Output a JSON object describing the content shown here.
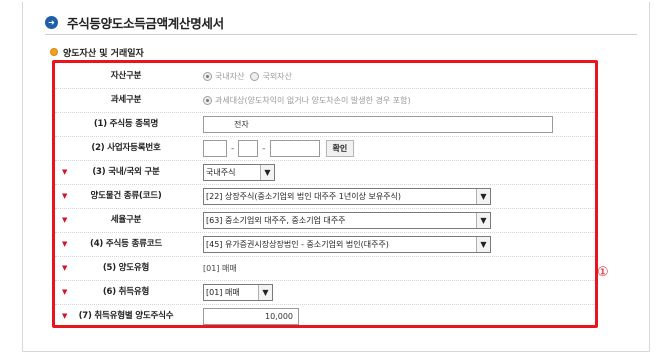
{
  "page": {
    "title": "주식등양도소득금액계산명세서",
    "section": "양도자산 및 거래일자"
  },
  "rows": [
    {
      "label": "자산구분",
      "required": false,
      "radios": [
        {
          "label": "국내자산",
          "checked": true
        },
        {
          "label": "국외자산",
          "checked": false
        }
      ]
    },
    {
      "label": "과세구분",
      "required": false,
      "radio_label": "과세대상(양도차익이 없거나 양도차손이 발생한 경우 포함)"
    },
    {
      "label": "(1) 주식등 종목명",
      "required": false,
      "value": "전자"
    },
    {
      "label": "(2) 사업자등록번호",
      "required": false,
      "parts": [
        "",
        "",
        ""
      ],
      "button": "확인"
    },
    {
      "label": "(3) 국내/국외 구분",
      "required": true,
      "selected": "국내주식"
    },
    {
      "label": "양도물건 종류(코드)",
      "required": true,
      "selected": "[22] 상장주식(중소기업외 법인 대주주 1년이상 보유주식)"
    },
    {
      "label": "세율구분",
      "required": true,
      "selected": "[63] 중소기업외 대주주, 중소기업 대주주"
    },
    {
      "label": "(4) 주식등 종류코드",
      "required": true,
      "selected": "[45] 유가증권시장상장법인 - 중소기업외 법인(대주주)"
    },
    {
      "label": "(5) 양도유형",
      "required": true,
      "value": "[01] 매매"
    },
    {
      "label": "(6) 취득유형",
      "required": true,
      "selected": "[01] 매매"
    },
    {
      "label": "(7) 취득유형별 양도주식수",
      "required": true,
      "value": "10,000"
    }
  ],
  "marker": "①",
  "colors": {
    "highlight_border": "#e8141e",
    "title_icon": "#1d5fa8",
    "section_icon": "#f1a020"
  },
  "icons": {
    "title": "arrow-circle-icon",
    "section": "bullet-icon",
    "dropdown": "chevron-down-icon"
  }
}
